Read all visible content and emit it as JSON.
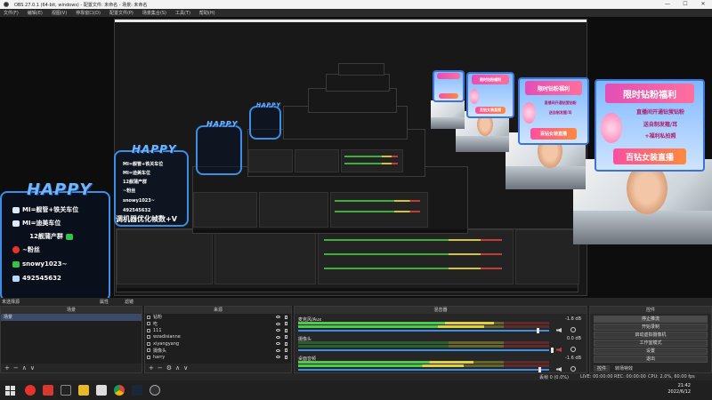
{
  "window": {
    "title": "OBS 27.0.1 (64-bit, windows) - 配置文件: 未命名 - 场景: 未命名",
    "controls": [
      "—",
      "☐",
      "✕"
    ]
  },
  "menu": [
    "文件(F)",
    "编辑(E)",
    "视图(V)",
    "停靠窗口(D)",
    "配置文件(P)",
    "场景集合(S)",
    "工具(T)",
    "帮助(H)"
  ],
  "overlay": {
    "happy_label": "HAPPY",
    "lines": [
      "MI=舰管+铁关车位",
      "MI=迪美车位",
      "12舰蒲产群",
      "~粉丝",
      "snowy1023~",
      "492545632"
    ],
    "watermark": "调机器优化帧数+V",
    "sub_caption": "未选择源",
    "promo": {
      "header": "限时钻粉福利",
      "line1": "直播间开通钻萤钻粉",
      "line2": "送自制发箍/耳",
      "line3": "+福利私拍照",
      "bottom": "百钻女装直播"
    }
  },
  "preview_toolbar": {
    "properties": "属性",
    "filters": "滤镜"
  },
  "docks": {
    "scenes": {
      "title": "场景",
      "items": [
        "场景"
      ]
    },
    "sources": {
      "title": "来源",
      "items": [
        "钻粉",
        "吃",
        "111",
        "wzadisianne",
        "xiyangyang",
        "摄像头",
        "harry"
      ]
    },
    "mixer": {
      "title": "混音器",
      "channels": [
        {
          "name": "麦克风/Aux",
          "db": "-1.8 dB"
        },
        {
          "name": "摄像头",
          "db": "0.0 dB"
        },
        {
          "name": "桌面音频",
          "db": "-1.6 dB"
        }
      ]
    },
    "controls": {
      "title": "控件",
      "buttons": [
        "停止推流",
        "开始录制",
        "启动虚拟摄像机",
        "工作室模式",
        "设置",
        "退出"
      ],
      "tabs": [
        "控件",
        "转场特效"
      ]
    }
  },
  "status": {
    "dropped": "丢帧 0 (0.0%)",
    "live": "LIVE: 00:00:00",
    "rec": "REC: 00:00:00",
    "cpu": "CPU: 2.0%, 60.00 fps"
  },
  "taskbar": {
    "time": "21:42",
    "date": "2022/6/12"
  },
  "colors": {
    "accent": "#3a8ee6",
    "meter_green": "#4ccb4c",
    "meter_yellow": "#e0cf3f",
    "meter_red": "#c13c3c"
  }
}
